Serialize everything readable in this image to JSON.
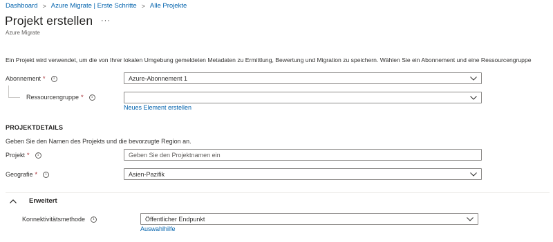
{
  "breadcrumb": {
    "items": [
      "Dashboard",
      "Azure Migrate | Erste Schritte",
      "Alle Projekte"
    ],
    "separator": ">"
  },
  "header": {
    "title": "Projekt erstellen",
    "more": "···",
    "subtitle": "Azure Migrate"
  },
  "intro": "Ein Projekt wird verwendet, um die von Ihrer lokalen Umgebung gemeldeten Metadaten zu Ermittlung, Bewertung und Migration zu speichern. Wählen Sie ein Abonnement und eine Ressourcengruppe",
  "form": {
    "subscription": {
      "label": "Abonnement",
      "required": "*",
      "value": "Azure-Abonnement 1"
    },
    "resource_group": {
      "label": "Ressourcengruppe",
      "required": "*",
      "value": "",
      "create_link": "Neues Element erstellen"
    }
  },
  "project_details": {
    "heading": "PROJEKTDETAILS",
    "description": "Geben Sie den Namen des Projekts und die bevorzugte Region an.",
    "project": {
      "label": "Projekt",
      "required": "*",
      "placeholder": "Geben Sie den Projektnamen ein"
    },
    "geography": {
      "label": "Geografie",
      "required": "*",
      "value": "Asien-Pazifik"
    }
  },
  "advanced": {
    "heading": "Erweitert",
    "connectivity": {
      "label": "Konnektivitätsmethode",
      "value": "Öffentlicher Endpunkt",
      "help_link": "Auswahlhilfe"
    }
  },
  "colors": {
    "link": "#0062ad",
    "required": "#a4262c",
    "border": "#8a8886",
    "text": "#323130"
  },
  "icons": {
    "info": "info-icon",
    "dropdown": "chevron-down-icon",
    "collapse": "chevron-up-icon",
    "more": "more-icon"
  }
}
